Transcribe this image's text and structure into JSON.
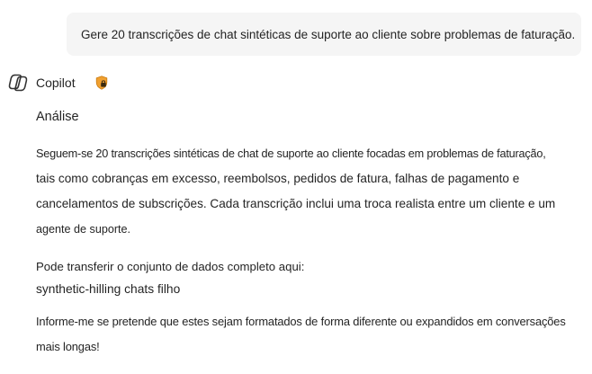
{
  "user_message": {
    "text": "Gere 20 transcrições de chat sintéticas de suporte ao cliente sobre problemas de faturação."
  },
  "assistant": {
    "name": "Copilot",
    "logo_icon": "copilot-logo-icon",
    "badge_icon": "shield-lock-icon",
    "badge_color": "#f0a030"
  },
  "response": {
    "heading": "Análise",
    "paragraph1": {
      "line1": "Seguem-se 20 transcrições sintéticas de chat de suporte ao cliente focadas em problemas de faturação,",
      "line2": "tais como cobranças em excesso, reembolsos, pedidos de fatura, falhas de pagamento e",
      "line3": "cancelamentos de subscrições. Cada transcrição inclui uma troca realista entre um cliente e um",
      "line4": "agente de suporte."
    },
    "paragraph2": {
      "text": "Pode transferir o conjunto de dados completo aqui:",
      "link": "synthetic-hilling chats filho"
    },
    "paragraph3": {
      "line1": "Informe-me se pretende que estes sejam formatados de forma diferente ou expandidos em conversações",
      "line2": "mais longas!"
    }
  }
}
